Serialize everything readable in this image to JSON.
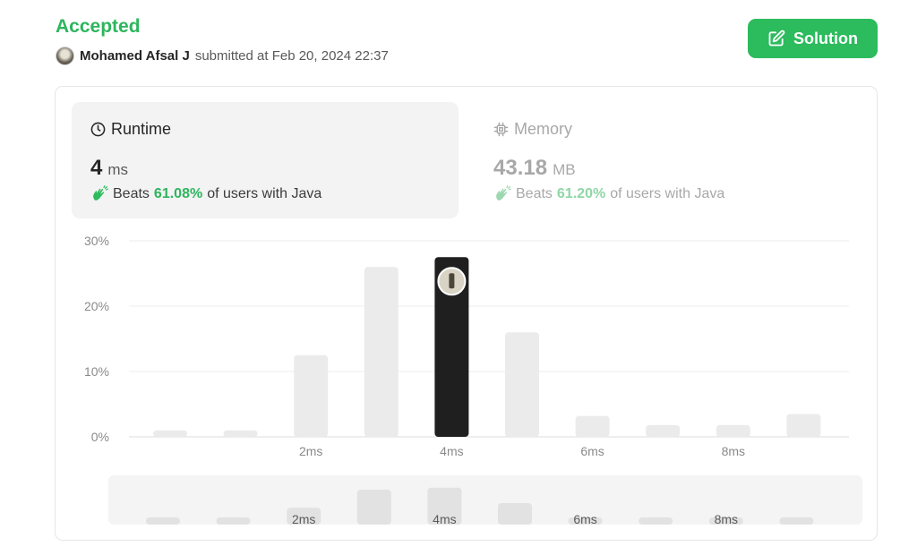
{
  "header": {
    "status": "Accepted",
    "author": "Mohamed Afsal J",
    "submitted_text": "submitted at Feb 20, 2024 22:37",
    "solution_label": "Solution"
  },
  "runtime": {
    "label": "Runtime",
    "value": "4",
    "unit": "ms",
    "beats_prefix": "Beats",
    "beats_pct": "61.08%",
    "beats_suffix": "of users with Java"
  },
  "memory": {
    "label": "Memory",
    "value": "43.18",
    "unit": "MB",
    "beats_prefix": "Beats",
    "beats_pct": "61.20%",
    "beats_suffix": "of users with Java"
  },
  "colors": {
    "accent_green": "#2cbb5d",
    "selected_bar": "#1f1f1f",
    "bar": "#ebebeb"
  },
  "chart_data": {
    "type": "bar",
    "yticks": [
      "30%",
      "20%",
      "10%",
      "0%"
    ],
    "ylim": [
      0,
      30
    ],
    "xtick_labels": [
      "",
      "",
      "2ms",
      "",
      "4ms",
      "",
      "6ms",
      "",
      "8ms",
      ""
    ],
    "values": [
      1.0,
      1.0,
      12.5,
      26,
      27.5,
      16,
      3.2,
      1.8,
      1.8,
      3.5
    ],
    "selected_index": 4,
    "grid": true,
    "brush_labels": [
      "2ms",
      "4ms",
      "6ms",
      "8ms"
    ]
  }
}
